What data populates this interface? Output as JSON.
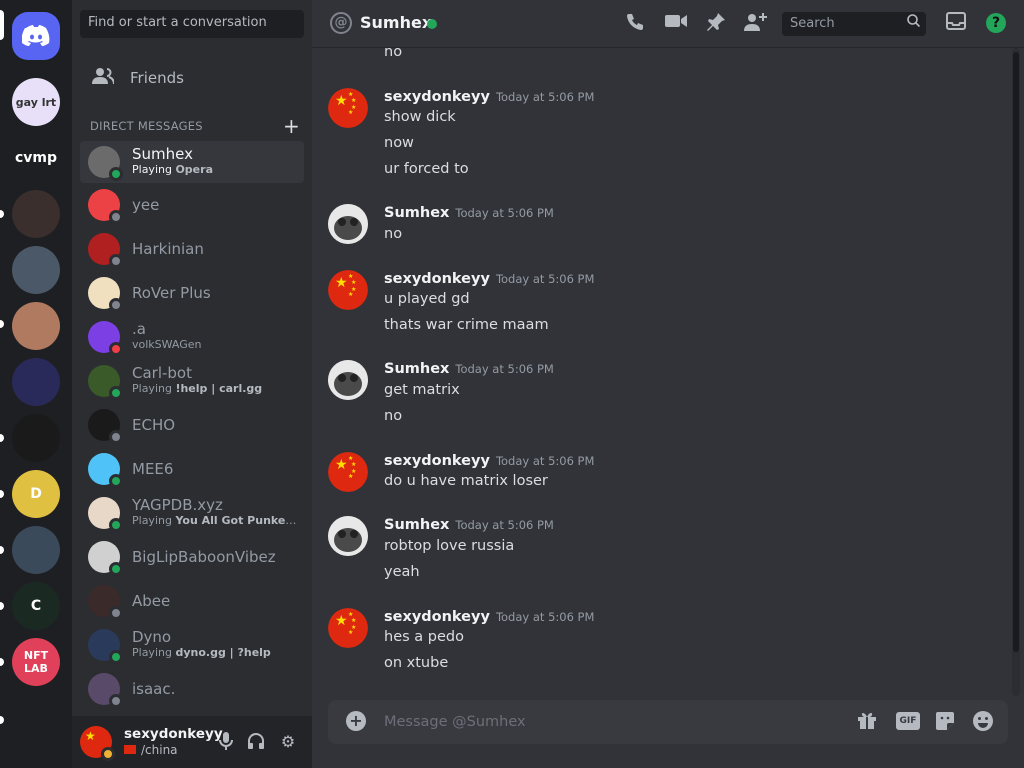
{
  "rail": {
    "servers": [
      {
        "name": "home",
        "label": "",
        "color": "#5865f2"
      },
      {
        "name": "gay-lrt",
        "label": "gay lrt",
        "color": "#e8e0f8"
      },
      {
        "name": "cvmp",
        "label": "cvmp",
        "color": "#1e1f22"
      },
      {
        "name": "server-3",
        "label": "",
        "color": "#3a2f2c"
      },
      {
        "name": "server-4",
        "label": "",
        "color": "#4a5868"
      },
      {
        "name": "server-5",
        "label": "",
        "color": "#b07a60"
      },
      {
        "name": "server-6",
        "label": "",
        "color": "#2a2a5a"
      },
      {
        "name": "valorant",
        "label": "",
        "color": "#1a1a1a"
      },
      {
        "name": "server-8",
        "label": "D",
        "color": "#e0c040"
      },
      {
        "name": "server-9",
        "label": "",
        "color": "#3a4a5a"
      },
      {
        "name": "server-10",
        "label": "C",
        "color": "#1a2a22"
      },
      {
        "name": "nft-lab",
        "label": "NFT LAB",
        "color": "#e0405a"
      },
      {
        "name": "server-12",
        "label": "",
        "color": "#1e1f22"
      }
    ]
  },
  "sidebar": {
    "search_placeholder": "Find or start a conversation",
    "friends_label": "Friends",
    "dm_header": "DIRECT MESSAGES",
    "dm_add": "+",
    "items": [
      {
        "name": "Sumhex",
        "sub_prefix": "Playing ",
        "sub_bold": "Opera",
        "status": "online",
        "color": "#6b6b6b",
        "active": true
      },
      {
        "name": "yee",
        "sub_prefix": "",
        "sub_bold": "",
        "status": "offline",
        "color": "#ed4245",
        "active": false
      },
      {
        "name": "Harkinian",
        "sub_prefix": "",
        "sub_bold": "",
        "status": "offline",
        "color": "#b02020",
        "active": false
      },
      {
        "name": "RoVer Plus",
        "sub_prefix": "",
        "sub_bold": "",
        "status": "offline",
        "color": "#f0e0c0",
        "active": false
      },
      {
        "name": ".a",
        "sub_prefix": "volkSWAGen",
        "sub_bold": "",
        "status": "dnd",
        "color": "#7b3fe4",
        "active": false
      },
      {
        "name": "Carl-bot",
        "sub_prefix": "Playing ",
        "sub_bold": "!help | carl.gg",
        "status": "online",
        "color": "#3a5a2a",
        "active": false
      },
      {
        "name": "ECHO",
        "sub_prefix": "",
        "sub_bold": "",
        "status": "offline",
        "color": "#1a1a1a",
        "active": false
      },
      {
        "name": "MEE6",
        "sub_prefix": "",
        "sub_bold": "",
        "status": "online",
        "color": "#4fc3f7",
        "active": false
      },
      {
        "name": "YAGPDB.xyz",
        "sub_prefix": "Playing ",
        "sub_bold": "You All Got Punked Du...",
        "status": "online",
        "color": "#e8d8c8",
        "active": false
      },
      {
        "name": "BigLipBaboonVibez",
        "sub_prefix": "",
        "sub_bold": "",
        "status": "online",
        "color": "#d0d0d0",
        "active": false
      },
      {
        "name": "Abee",
        "sub_prefix": "",
        "sub_bold": "",
        "status": "offline",
        "color": "#3a2a2a",
        "active": false
      },
      {
        "name": "Dyno",
        "sub_prefix": "Playing ",
        "sub_bold": "dyno.gg | ?help",
        "status": "online",
        "color": "#2a3a5a",
        "active": false
      },
      {
        "name": "isaac.",
        "sub_prefix": "",
        "sub_bold": "",
        "status": "offline",
        "color": "#5a4a6a",
        "active": false
      }
    ]
  },
  "user_panel": {
    "username": "sexydonkeyy",
    "status": "/china"
  },
  "header": {
    "at_symbol": "@",
    "channel_name": "Sumhex",
    "search_placeholder": "Search",
    "help": "?"
  },
  "messages": [
    {
      "author": "",
      "time": "",
      "lines": [
        "no"
      ],
      "avatar": "none"
    },
    {
      "author": "sexydonkeyy",
      "time": "Today at 5:06 PM",
      "lines": [
        "show dick",
        "now",
        "ur forced to"
      ],
      "avatar": "flag"
    },
    {
      "author": "Sumhex",
      "time": "Today at 5:06 PM",
      "lines": [
        "no"
      ],
      "avatar": "sumhex"
    },
    {
      "author": "sexydonkeyy",
      "time": "Today at 5:06 PM",
      "lines": [
        "u played gd",
        "thats war crime maam"
      ],
      "avatar": "flag"
    },
    {
      "author": "Sumhex",
      "time": "Today at 5:06 PM",
      "lines": [
        "get matrix",
        "no"
      ],
      "avatar": "sumhex"
    },
    {
      "author": "sexydonkeyy",
      "time": "Today at 5:06 PM",
      "lines": [
        "do u have matrix loser"
      ],
      "avatar": "flag"
    },
    {
      "author": "Sumhex",
      "time": "Today at 5:06 PM",
      "lines": [
        "robtop love russia",
        "yeah"
      ],
      "avatar": "sumhex"
    },
    {
      "author": "sexydonkeyy",
      "time": "Today at 5:06 PM",
      "lines": [
        "hes a pedo",
        "on xtube"
      ],
      "avatar": "flag"
    }
  ],
  "composer": {
    "placeholder": "Message @Sumhex",
    "gif_label": "GIF"
  }
}
